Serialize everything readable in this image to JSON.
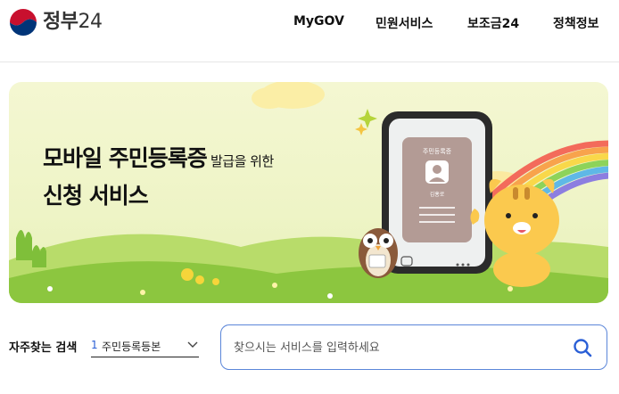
{
  "header": {
    "logo_text": "정부",
    "logo_number": "24",
    "nav": [
      "MyGOV",
      "민원서비스",
      "보조금24",
      "정책정보"
    ]
  },
  "banner": {
    "title_strong": "모바일 주민등록증",
    "title_small": " 발급을 위한",
    "title_line2": "신청 서비스",
    "card_title": "주민등록증",
    "card_name": "김홍로"
  },
  "search": {
    "frequent_label": "자주찾는 검색",
    "frequent_rank": "1",
    "frequent_item": "주민등록등본",
    "placeholder": "찾으시는 서비스를 입력하세요"
  },
  "colors": {
    "brand_blue": "#2a5fd6",
    "search_border": "#5b86d9",
    "banner_bg": "#f4f7d2",
    "grass": "#8cc63f"
  }
}
